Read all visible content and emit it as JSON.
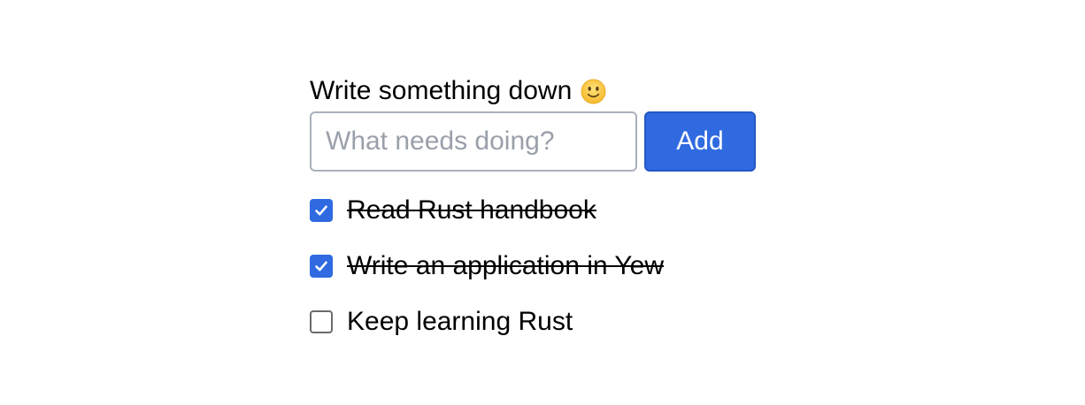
{
  "header": {
    "title": "Write something down",
    "emoji_icon": "slightly-smiling-face-icon"
  },
  "form": {
    "input_value": "",
    "input_placeholder": "What needs doing?",
    "add_label": "Add"
  },
  "todos": [
    {
      "label": "Read Rust handbook",
      "checked": true
    },
    {
      "label": "Write an application in Yew",
      "checked": true
    },
    {
      "label": "Keep learning Rust",
      "checked": false
    }
  ],
  "colors": {
    "accent": "#2f6ae0",
    "input_border": "#aab0bc",
    "placeholder": "#9aa0aa"
  }
}
